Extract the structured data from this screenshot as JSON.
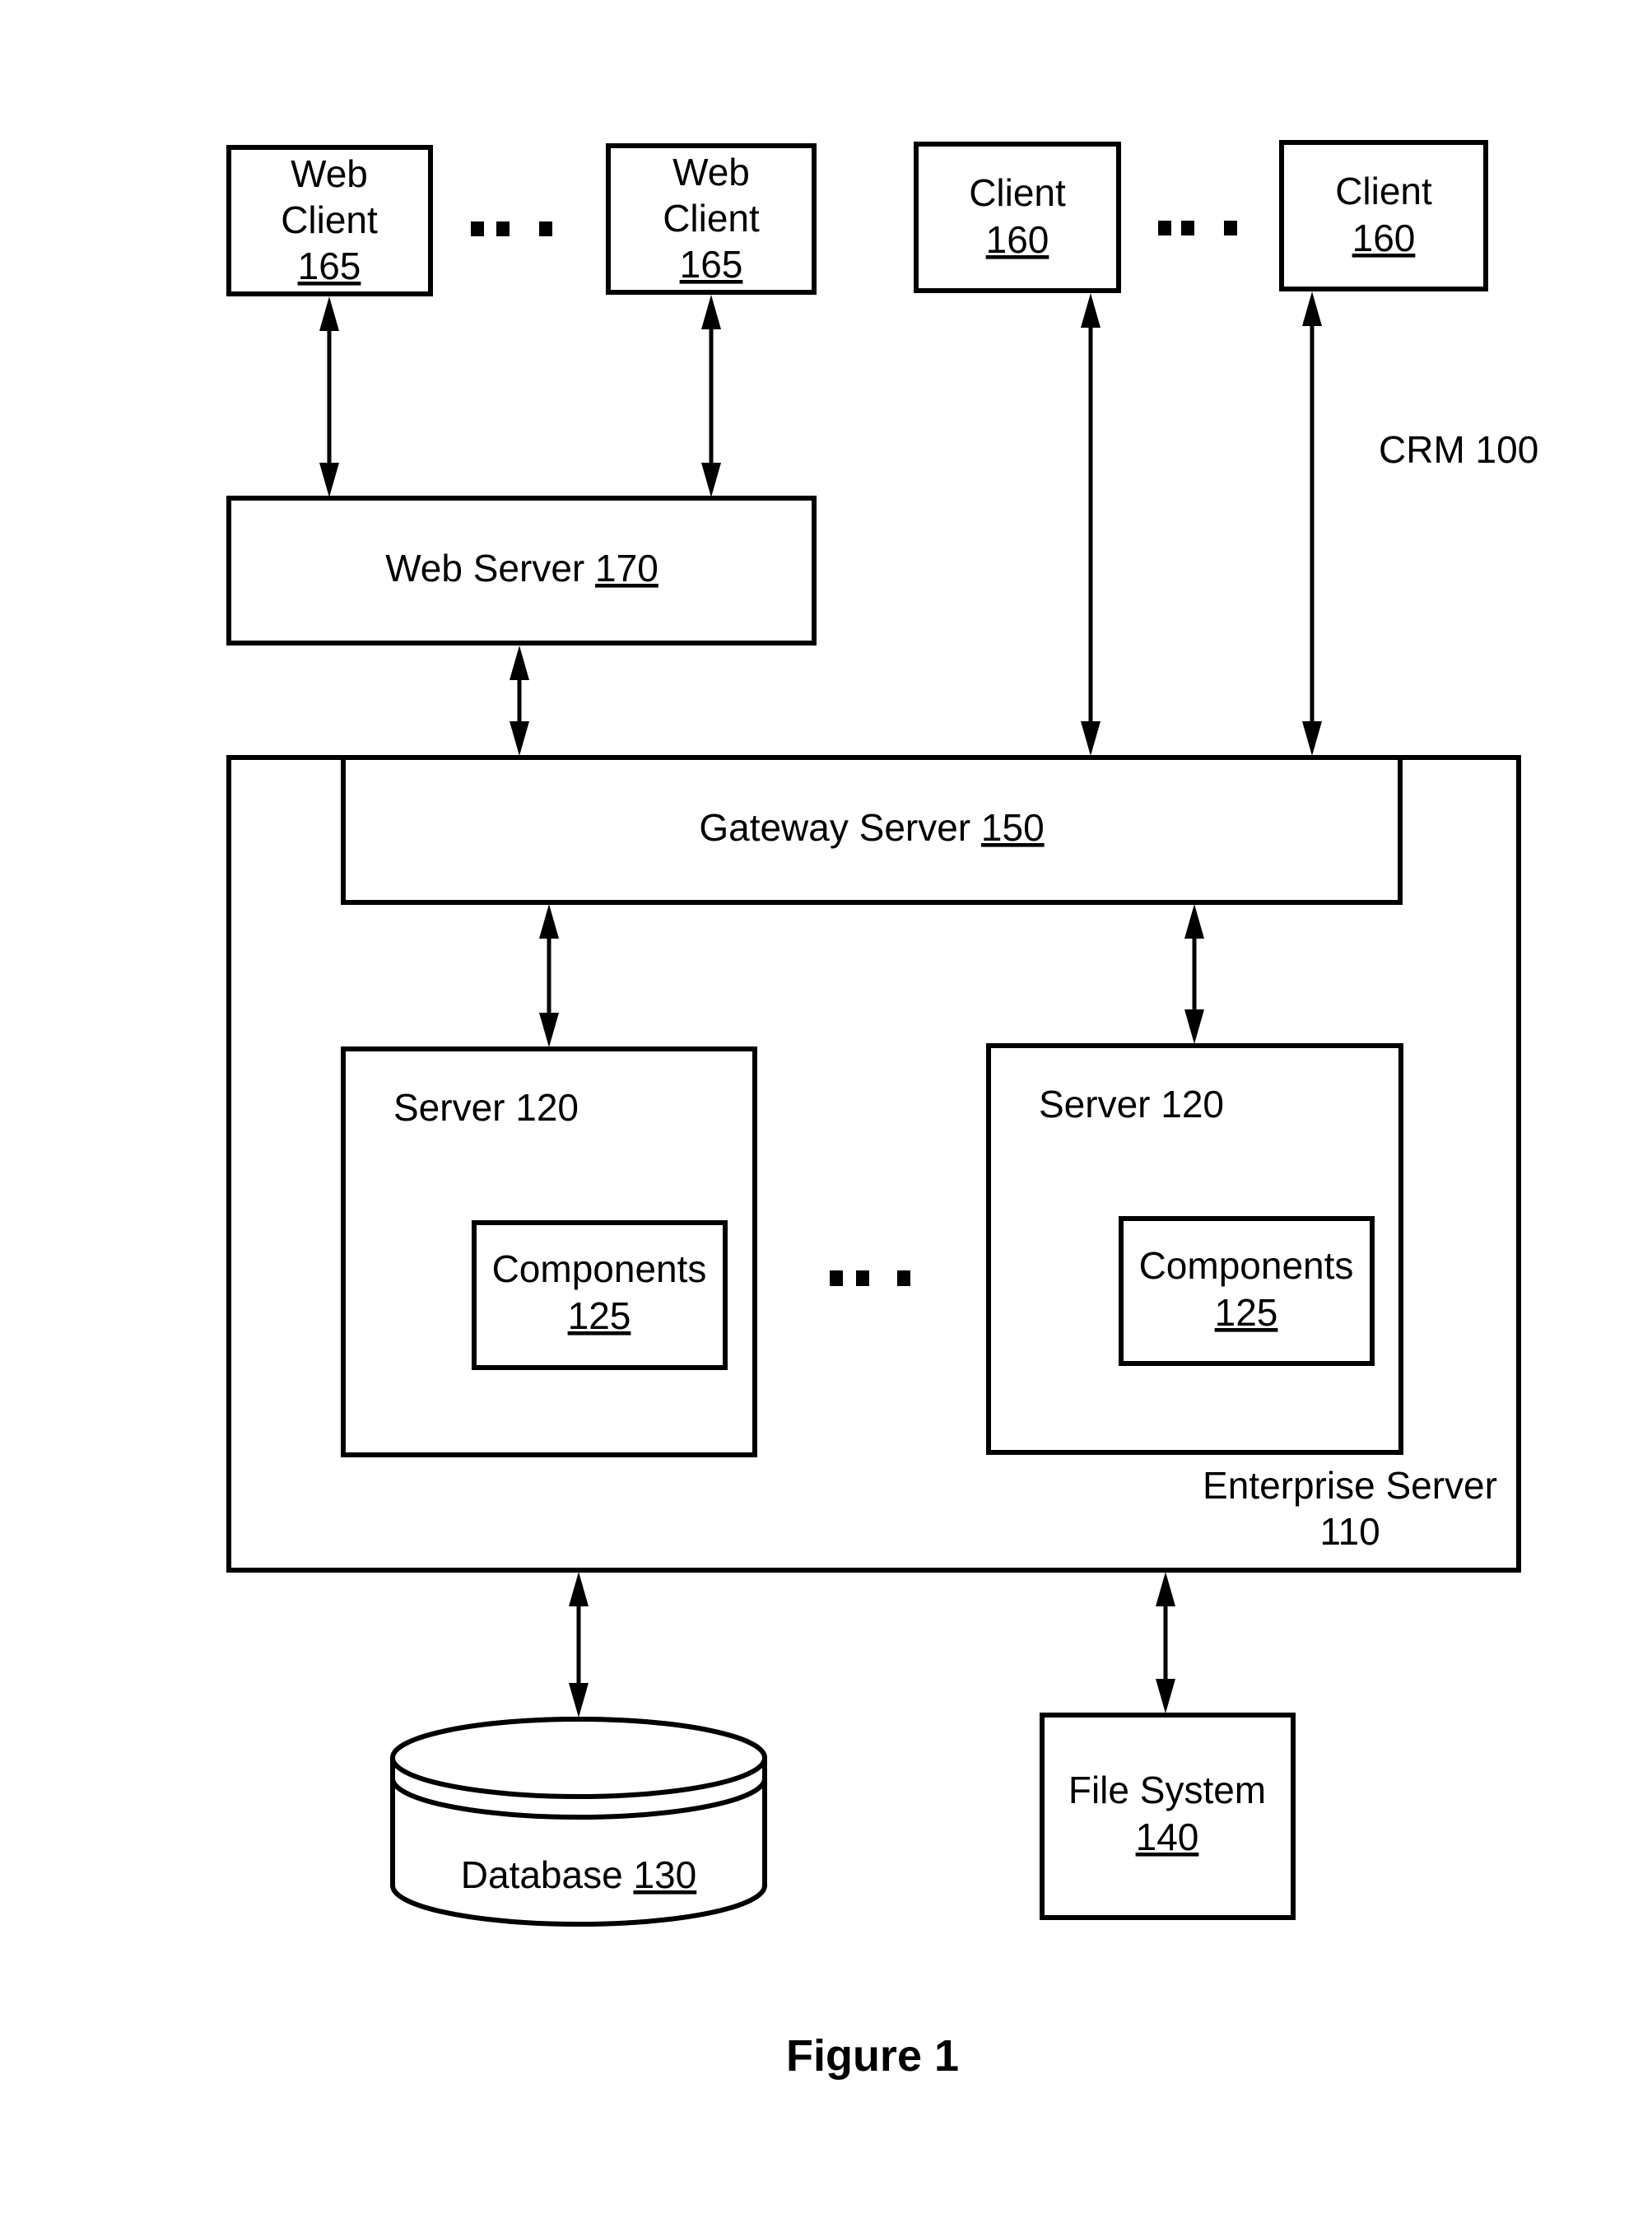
{
  "diagram": {
    "system_label": "CRM 100",
    "figure_caption": "Figure 1",
    "web_clients": [
      {
        "line1": "Web",
        "line2": "Client",
        "ref": "165"
      },
      {
        "line1": "Web",
        "line2": "Client",
        "ref": "165"
      }
    ],
    "clients": [
      {
        "label": "Client",
        "ref": "160"
      },
      {
        "label": "Client",
        "ref": "160"
      }
    ],
    "web_server": {
      "label": "Web Server",
      "ref": "170"
    },
    "enterprise_server": {
      "line1": "Enterprise Server",
      "line2": "110"
    },
    "gateway_server": {
      "label": "Gateway Server",
      "ref": "150"
    },
    "servers": [
      {
        "label": "Server 120",
        "component_label": "Components",
        "component_ref": "125"
      },
      {
        "label": "Server 120",
        "component_label": "Components",
        "component_ref": "125"
      }
    ],
    "database": {
      "label": "Database",
      "ref": "130"
    },
    "file_system": {
      "line1": "File System",
      "ref": "140"
    },
    "ellipsis_marks": [
      "web-clients",
      "clients",
      "servers"
    ],
    "connections": [
      {
        "from": "Web Client 165",
        "to": "Web Server 170",
        "type": "bidirectional"
      },
      {
        "from": "Web Client 165",
        "to": "Web Server 170",
        "type": "bidirectional"
      },
      {
        "from": "Web Server 170",
        "to": "Gateway Server 150",
        "type": "bidirectional"
      },
      {
        "from": "Client 160",
        "to": "Gateway Server 150",
        "type": "bidirectional"
      },
      {
        "from": "Client 160",
        "to": "Gateway Server 150",
        "type": "bidirectional"
      },
      {
        "from": "Gateway Server 150",
        "to": "Server 120",
        "type": "bidirectional"
      },
      {
        "from": "Gateway Server 150",
        "to": "Server 120",
        "type": "bidirectional"
      },
      {
        "from": "Enterprise Server 110",
        "to": "Database 130",
        "type": "bidirectional"
      },
      {
        "from": "Enterprise Server 110",
        "to": "File System 140",
        "type": "bidirectional"
      }
    ]
  }
}
